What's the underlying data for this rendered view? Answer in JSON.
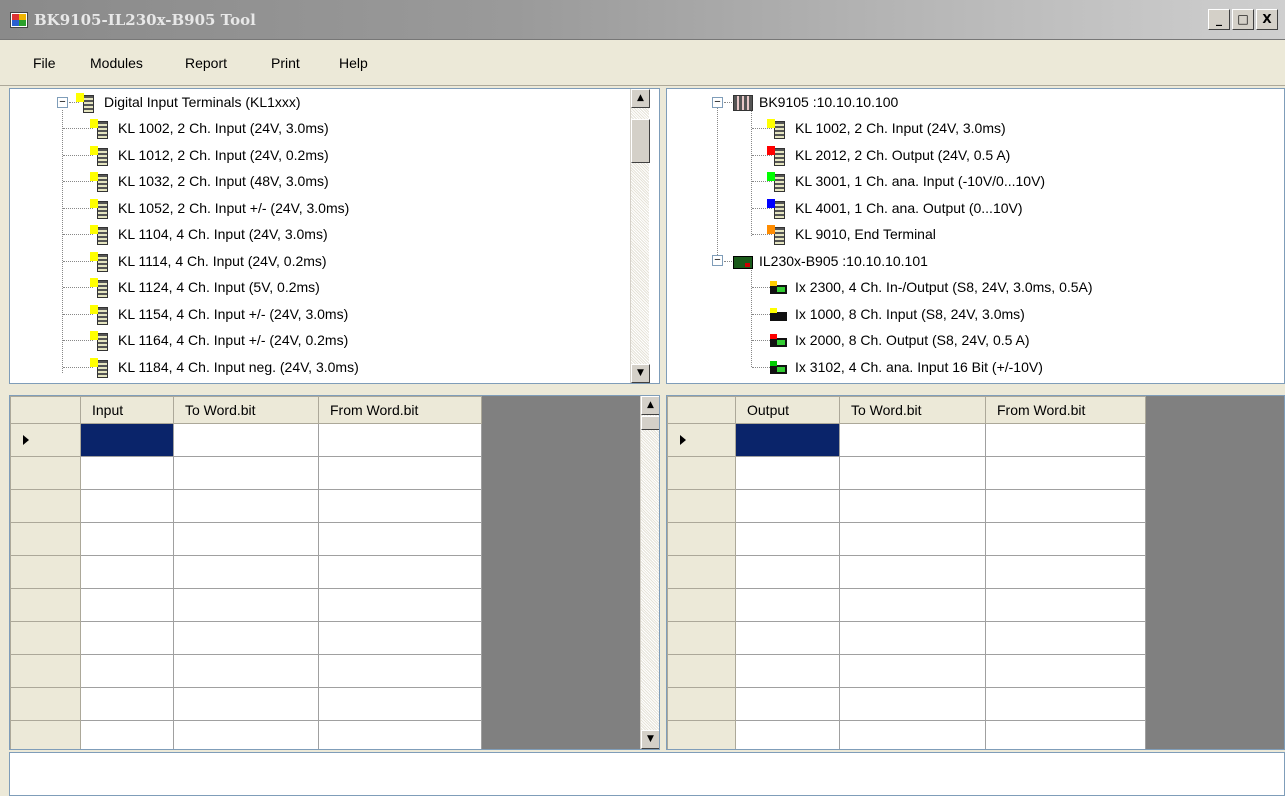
{
  "window": {
    "title": "BK9105-IL230x-B905 Tool",
    "min": "_",
    "max": "□",
    "close": "X"
  },
  "menu": [
    "File",
    "Modules",
    "Report",
    "Print",
    "Help"
  ],
  "left_tree": {
    "root": "Digital Input Terminals (KL1xxx)",
    "items": [
      "KL 1002, 2 Ch. Input (24V, 3.0ms)",
      "KL 1012, 2 Ch. Input (24V, 0.2ms)",
      "KL 1032, 2 Ch. Input (48V, 3.0ms)",
      "KL 1052, 2 Ch. Input +/- (24V, 3.0ms)",
      "KL 1104, 4 Ch. Input (24V, 3.0ms)",
      "KL 1114, 4 Ch. Input (24V, 0.2ms)",
      "KL 1124, 4 Ch. Input (5V, 0.2ms)",
      "KL 1154, 4 Ch. Input +/- (24V, 3.0ms)",
      "KL 1164, 4 Ch. Input +/- (24V, 0.2ms)",
      "KL 1184, 4 Ch. Input neg. (24V, 3.0ms)"
    ]
  },
  "right_tree": {
    "bk": {
      "label": "BK9105 :10.10.10.100",
      "items": [
        {
          "label": "KL 1002, 2 Ch. Input (24V, 3.0ms)",
          "color": "#ffff00"
        },
        {
          "label": "KL 2012, 2 Ch. Output (24V, 0.5 A)",
          "color": "#ff0000"
        },
        {
          "label": "KL 3001, 1 Ch. ana. Input (-10V/0...10V)",
          "color": "#00ff00"
        },
        {
          "label": "KL 4001, 1 Ch. ana. Output (0...10V)",
          "color": "#0000ff"
        },
        {
          "label": "KL 9010, End Terminal",
          "color": "#ff8c00"
        }
      ]
    },
    "il": {
      "label": "IL230x-B905 :10.10.10.101",
      "items": [
        {
          "label": "Ix 2300, 4 Ch. In-/Output (S8, 24V, 3.0ms, 0.5A)",
          "color": "#ffcc00"
        },
        {
          "label": "Ix 1000, 8 Ch. Input (S8, 24V, 3.0ms)",
          "color": "#ffff00"
        },
        {
          "label": "Ix 2000, 8 Ch. Output (S8, 24V, 0.5 A)",
          "color": "#ff0000"
        },
        {
          "label": "Ix 3102, 4 Ch. ana. Input 16 Bit (+/-10V)",
          "color": "#00cc00"
        }
      ]
    }
  },
  "left_grid": {
    "headers": [
      "Input",
      "To Word.bit",
      "From Word.bit"
    ]
  },
  "right_grid": {
    "headers": [
      "Output",
      "To Word.bit",
      "From Word.bit"
    ]
  }
}
